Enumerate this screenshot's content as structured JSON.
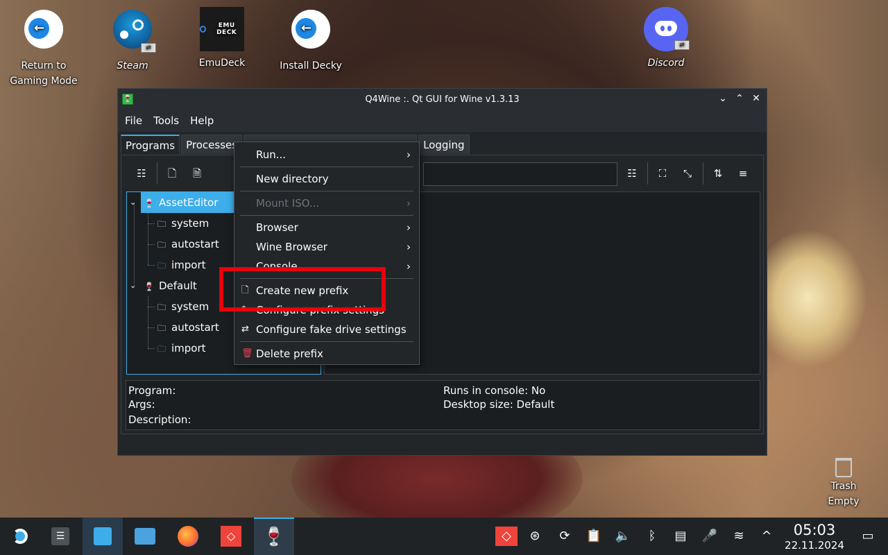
{
  "desktop": {
    "icons": [
      {
        "label": "Return to Gaming Mode",
        "icon": "back-arrow-icon"
      },
      {
        "label": "Steam",
        "icon": "steam-icon"
      },
      {
        "label": "EmuDeck",
        "icon": "emudeck-icon",
        "logo_text": "EMU DECK"
      },
      {
        "label": "Install Decky",
        "icon": "back-arrow-icon"
      },
      {
        "label": "Discord",
        "icon": "discord-icon"
      }
    ],
    "trash": {
      "label": "Trash",
      "status": "Empty"
    }
  },
  "window": {
    "title": "Q4Wine :. Qt GUI for Wine v1.3.13",
    "menu": [
      "File",
      "Tools",
      "Help"
    ],
    "tabs": [
      "Programs",
      "Processes",
      "Logging"
    ],
    "active_tab": "Programs",
    "tree": [
      {
        "label": "AssetEditor",
        "selected": true,
        "children": [
          "system",
          "autostart",
          "import"
        ]
      },
      {
        "label": "Default",
        "selected": false,
        "children": [
          "system",
          "autostart",
          "import"
        ]
      }
    ],
    "info": {
      "program": "Program:",
      "args": "Args:",
      "description": "Description:",
      "runs_in_console": "Runs in console: No",
      "desktop_size": "Desktop size: Default"
    }
  },
  "context_menu": {
    "items": [
      {
        "label": "Run...",
        "submenu": true
      },
      {
        "label": "New directory"
      },
      {
        "label": "Mount ISO...",
        "disabled": true,
        "submenu": true
      },
      {
        "label": "Browser",
        "submenu": true
      },
      {
        "label": "Wine Browser",
        "submenu": true
      },
      {
        "label": "Console",
        "submenu": true
      },
      {
        "label": "Create new prefix",
        "icon": "new-file-icon"
      },
      {
        "label": "Configure prefix settings"
      },
      {
        "label": "Configure fake drive settings",
        "icon": "settings-icon"
      },
      {
        "label": "Delete prefix",
        "icon": "trash-icon"
      }
    ],
    "highlight_color": "#e8000b"
  },
  "taskbar": {
    "clock_time": "05:03",
    "clock_date": "22.11.2024",
    "accent": "#3daee9"
  }
}
